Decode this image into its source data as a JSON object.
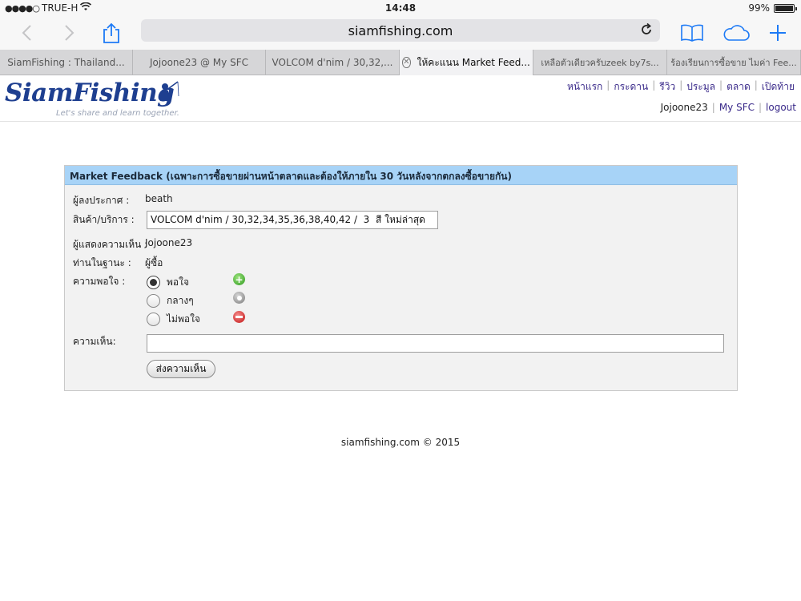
{
  "status_bar": {
    "signal_dots": "●●●●○",
    "carrier": "TRUE-H",
    "time": "14:48",
    "battery_percent": "99%",
    "battery_level": 0.99
  },
  "browser": {
    "url": "siamfishing.com",
    "tabs": [
      {
        "label": "SiamFishing : Thailand..."
      },
      {
        "label": "Jojoone23 @ My SFC"
      },
      {
        "label": "VOLCOM d'nim / 30,32,..."
      },
      {
        "label": "ให้คะแนน Market Feed...",
        "active": true
      },
      {
        "label": "เหลือตัวเดียวครับzeek by7s..."
      },
      {
        "label": "ร้องเรียนการซื้อขาย ไมค่า Fee..."
      }
    ],
    "accent_color": "#1d7af6"
  },
  "site": {
    "logo_text": "SiamFishing",
    "tagline": "Let's share and learn together.",
    "nav": [
      "หน้าแรก",
      "กระดาน",
      "รีวิว",
      "ประมูล",
      "ตลาด",
      "เปิดท้าย"
    ],
    "username": "Jojoone23",
    "my_sfc": "My SFC",
    "logout": "logout",
    "separator": "|"
  },
  "feedback": {
    "title": "Market Feedback (เฉพาะการซื้อขายผ่านหน้าตลาดและต้องให้ภายใน 30 วันหลังจากตกลงซื้อขายกัน)",
    "poster_label": "ผู้ลงประกาศ :",
    "poster_value": "beath",
    "product_label": "สินค้า/บริการ :",
    "product_value": "VOLCOM d'nim / 30,32,34,35,36,38,40,42 /  3  สี ใหม่ล่าสุด",
    "commenter_label": "ผู้แสดงความเห็น :",
    "commenter_value": "Jojoone23",
    "role_label": "ท่านในฐานะ :",
    "role_value": "ผู้ซื้อ",
    "satisfaction_label": "ความพอใจ :",
    "options": [
      {
        "label": "พอใจ",
        "checked": true,
        "icon": "plus-circle-icon",
        "color": "#2f9a1f"
      },
      {
        "label": "กลางๆ",
        "checked": false,
        "icon": "neutral-circle-icon",
        "color": "#7b7b7b"
      },
      {
        "label": "ไม่พอใจ",
        "checked": false,
        "icon": "minus-circle-icon",
        "color": "#c21515"
      }
    ],
    "comment_label": "ความเห็น:",
    "comment_value": "",
    "submit_label": "ส่งความเห็น",
    "header_color": "#a7d3f7"
  },
  "footer": {
    "text": "siamfishing.com © 2015"
  }
}
